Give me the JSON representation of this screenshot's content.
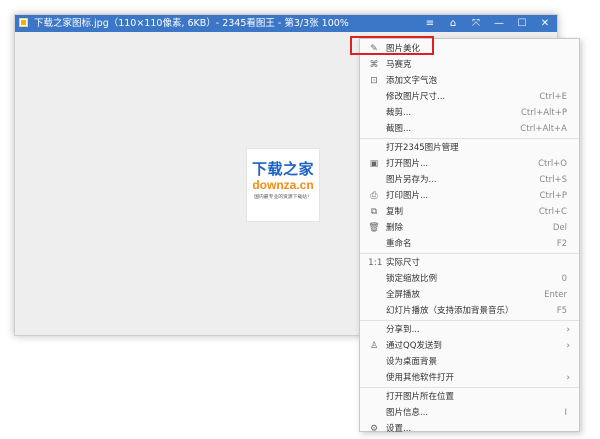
{
  "window": {
    "title": "下载之家图标.jpg（110×110像素, 6KB）- 2345看图王 - 第3/3张 100%",
    "controls": [
      "≡",
      "⌂",
      "⤧",
      "—",
      "☐",
      "✕"
    ]
  },
  "image": {
    "logo_line1": "下载之家",
    "logo_line2": "downza.cn",
    "logo_line3": "国内最专业的资源下载站！"
  },
  "menu": {
    "group1": [
      {
        "label": "图片美化",
        "icon": "✎",
        "shortcut": ""
      },
      {
        "label": "马赛克",
        "icon": "⌘",
        "shortcut": ""
      },
      {
        "label": "添加文字气泡",
        "icon": "⊡",
        "shortcut": ""
      },
      {
        "label": "修改图片尺寸...",
        "icon": "",
        "shortcut": "Ctrl+E"
      },
      {
        "label": "裁剪...",
        "icon": "",
        "shortcut": "Ctrl+Alt+P"
      },
      {
        "label": "截图...",
        "icon": "",
        "shortcut": "Ctrl+Alt+A"
      }
    ],
    "group2": [
      {
        "label": "打开2345图片管理",
        "icon": "",
        "shortcut": ""
      },
      {
        "label": "打开图片...",
        "icon": "▣",
        "shortcut": "Ctrl+O"
      },
      {
        "label": "图片另存为...",
        "icon": "",
        "shortcut": "Ctrl+S"
      },
      {
        "label": "打印图片...",
        "icon": "⎙",
        "shortcut": "Ctrl+P"
      },
      {
        "label": "复制",
        "icon": "⧉",
        "shortcut": "Ctrl+C"
      },
      {
        "label": "删除",
        "icon": "🗑",
        "shortcut": "Del"
      },
      {
        "label": "重命名",
        "icon": "",
        "shortcut": "F2"
      }
    ],
    "group3": [
      {
        "label": "实际尺寸",
        "icon": "1:1",
        "shortcut": ""
      },
      {
        "label": "锁定缩放比例",
        "icon": "",
        "shortcut": "0"
      },
      {
        "label": "全屏播放",
        "icon": "",
        "shortcut": "Enter"
      },
      {
        "label": "幻灯片播放（支持添加背景音乐）",
        "icon": "",
        "shortcut": "F5"
      }
    ],
    "group4": [
      {
        "label": "分享到...",
        "icon": "",
        "arrow": "›"
      },
      {
        "label": "通过QQ发送到",
        "icon": "♙",
        "arrow": "›"
      },
      {
        "label": "设为桌面背景",
        "icon": "",
        "arrow": ""
      },
      {
        "label": "使用其他软件打开",
        "icon": "",
        "arrow": "›"
      }
    ],
    "group5": [
      {
        "label": "打开图片所在位置",
        "icon": "",
        "shortcut": ""
      },
      {
        "label": "图片信息...",
        "icon": "",
        "shortcut": "I"
      },
      {
        "label": "设置...",
        "icon": "⚙",
        "shortcut": ""
      }
    ]
  },
  "colors": {
    "titlebar": "#3b77c6",
    "highlight": "#e02020",
    "logo_blue": "#1b62c2",
    "logo_orange": "#f28c12"
  }
}
